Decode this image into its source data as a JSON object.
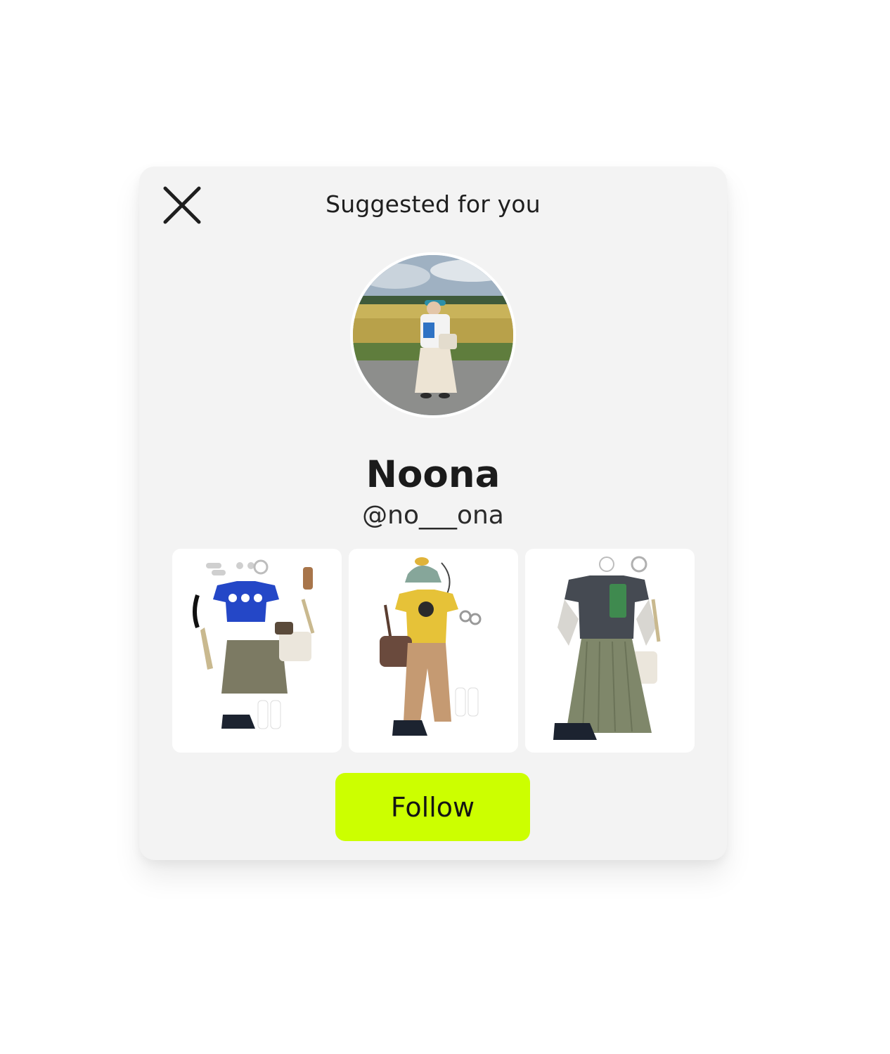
{
  "dialog": {
    "title": "Suggested for you",
    "close_icon": "close-icon"
  },
  "profile": {
    "name": "Noona",
    "handle": "@no___ona"
  },
  "outfits": [
    {
      "tone": "blue-tee-khaki-skirt"
    },
    {
      "tone": "yellow-tee-tan-pants"
    },
    {
      "tone": "grey-tee-olive-maxi-skirt"
    }
  ],
  "actions": {
    "follow_label": "Follow",
    "follow_color": "#ccff00"
  }
}
